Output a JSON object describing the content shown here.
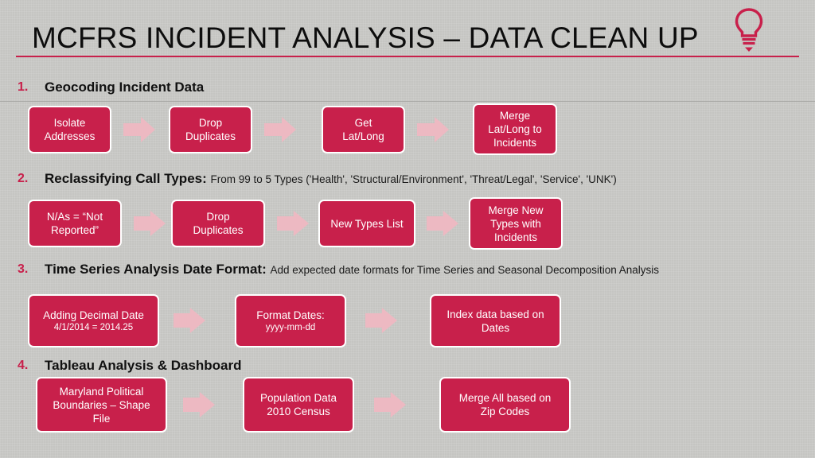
{
  "slide": {
    "title": "MCFRS INCIDENT ANALYSIS – DATA CLEAN UP",
    "icon": "lightbulb-icon",
    "accent_color": "#c8204b",
    "arrow_color": "#edb9c2",
    "background_color": "#c9c9c6",
    "box_text_color": "#ffffff"
  },
  "sections": [
    {
      "number": "1.",
      "heading": "Geocoding Incident Data",
      "subtext": "",
      "steps": [
        {
          "line1": "Isolate",
          "line2": "Addresses"
        },
        {
          "line1": "Drop",
          "line2": "Duplicates"
        },
        {
          "line1": "Get",
          "line2": "Lat/Long"
        },
        {
          "line1": "Merge",
          "line2": "Lat/Long to",
          "line3": "Incidents"
        }
      ],
      "arrow_count": 3
    },
    {
      "number": "2.",
      "heading": "Reclassifying Call Types:",
      "subtext": "From 99 to 5 Types ('Health', 'Structural/Environment', 'Threat/Legal', 'Service', 'UNK')",
      "steps": [
        {
          "line1": "N/As = “Not",
          "line2": "Reported”"
        },
        {
          "line1": "Drop",
          "line2": "Duplicates"
        },
        {
          "line1": "New Types List",
          "line2": ""
        },
        {
          "line1": "Merge New",
          "line2": "Types with",
          "line3": "Incidents"
        }
      ],
      "arrow_count": 3
    },
    {
      "number": "3.",
      "heading": "Time Series Analysis Date Format:",
      "subtext": "Add expected date formats for Time Series and Seasonal Decomposition Analysis",
      "steps": [
        {
          "line1": "Adding Decimal Date",
          "line2": "4/1/2014 = 2014.25",
          "small2": true
        },
        {
          "line1": "Format Dates:",
          "line2": "yyyy-mm-dd",
          "small2": true
        },
        {
          "line1": "Index data based on",
          "line2": "Dates"
        }
      ],
      "arrow_count": 2
    },
    {
      "number": "4.",
      "heading": "Tableau Analysis & Dashboard",
      "subtext": "",
      "steps": [
        {
          "line1": "Maryland Political",
          "line2": "Boundaries – Shape",
          "line3": "File"
        },
        {
          "line1": "Population Data",
          "line2": "2010 Census"
        },
        {
          "line1": "Merge All based on",
          "line2": "Zip Codes"
        }
      ],
      "arrow_count": 2
    }
  ]
}
